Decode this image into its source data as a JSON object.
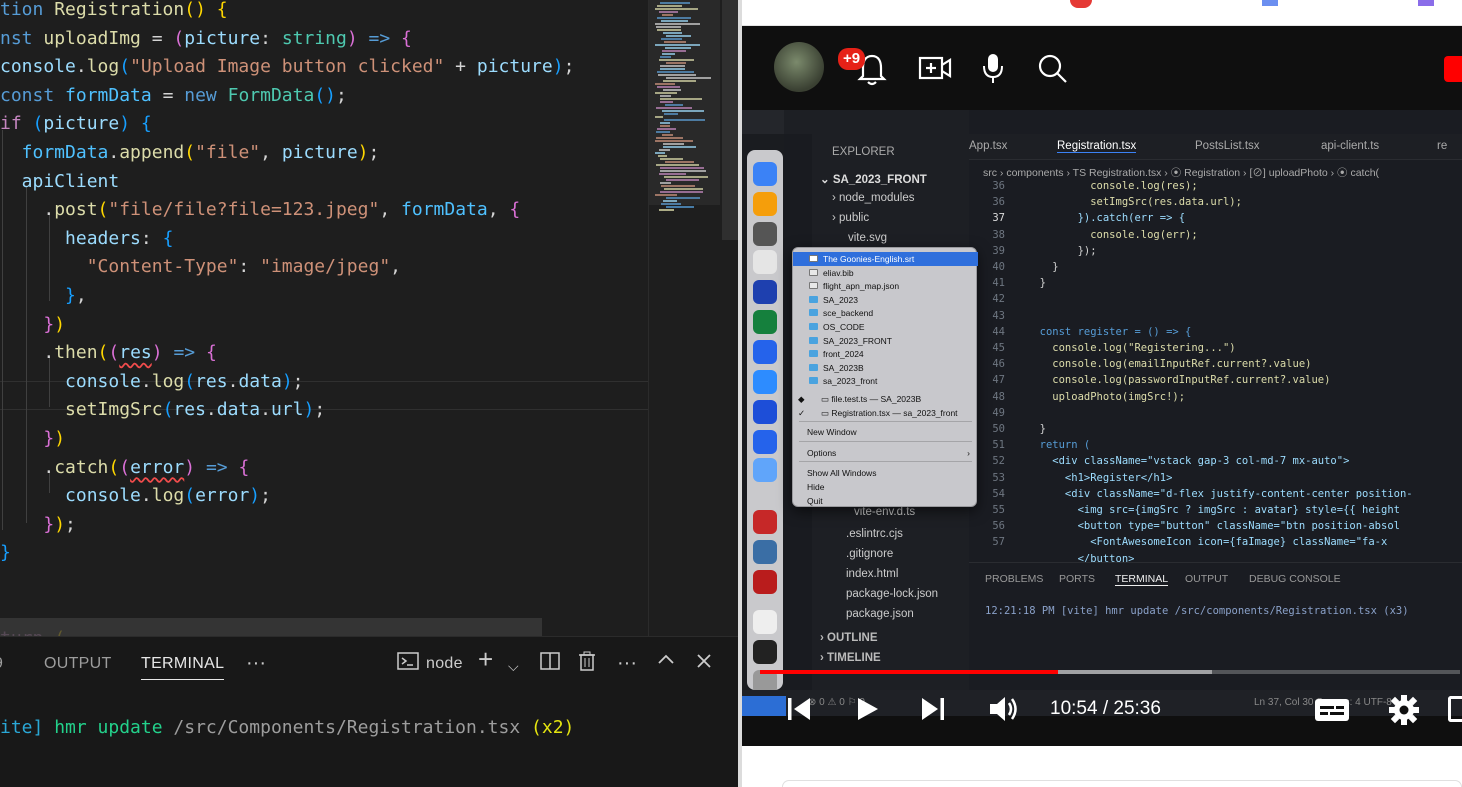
{
  "editor": {
    "lines": [
      [
        {
          "t": "tion ",
          "c": "#569cd6"
        },
        {
          "t": "Registration",
          "c": "#dcdcaa"
        },
        {
          "t": "() {",
          "c": "#ffd700"
        }
      ],
      [
        {
          "t": "nst ",
          "c": "#569cd6"
        },
        {
          "t": "uploadImg",
          "c": "#dcdcaa"
        },
        {
          "t": " = ",
          "c": "#d4d4d4"
        },
        {
          "t": "(",
          "c": "#da70d6"
        },
        {
          "t": "picture",
          "c": "#9cdcfe"
        },
        {
          "t": ": ",
          "c": "#d4d4d4"
        },
        {
          "t": "string",
          "c": "#4ec9b0"
        },
        {
          "t": ") ",
          "c": "#da70d6"
        },
        {
          "t": "=> ",
          "c": "#569cd6"
        },
        {
          "t": "{",
          "c": "#da70d6"
        }
      ],
      [
        {
          "t": "console",
          "c": "#9cdcfe"
        },
        {
          "t": ".",
          "c": "#d4d4d4"
        },
        {
          "t": "log",
          "c": "#dcdcaa"
        },
        {
          "t": "(",
          "c": "#179fff"
        },
        {
          "t": "\"Upload Image button clicked\"",
          "c": "#ce9178"
        },
        {
          "t": " + ",
          "c": "#d4d4d4"
        },
        {
          "t": "picture",
          "c": "#9cdcfe"
        },
        {
          "t": ")",
          "c": "#179fff"
        },
        {
          "t": ";",
          "c": "#d4d4d4"
        }
      ],
      [
        {
          "t": "const ",
          "c": "#569cd6"
        },
        {
          "t": "formData",
          "c": "#4fc1ff"
        },
        {
          "t": " = ",
          "c": "#d4d4d4"
        },
        {
          "t": "new ",
          "c": "#569cd6"
        },
        {
          "t": "FormData",
          "c": "#4ec9b0"
        },
        {
          "t": "()",
          "c": "#179fff"
        },
        {
          "t": ";",
          "c": "#d4d4d4"
        }
      ],
      [
        {
          "t": "if ",
          "c": "#c586c0"
        },
        {
          "t": "(",
          "c": "#179fff"
        },
        {
          "t": "picture",
          "c": "#9cdcfe"
        },
        {
          "t": ") ",
          "c": "#179fff"
        },
        {
          "t": "{",
          "c": "#179fff"
        }
      ],
      [
        {
          "t": "  formData",
          "c": "#4fc1ff"
        },
        {
          "t": ".",
          "c": "#d4d4d4"
        },
        {
          "t": "append",
          "c": "#dcdcaa"
        },
        {
          "t": "(",
          "c": "#ffd700"
        },
        {
          "t": "\"file\"",
          "c": "#ce9178"
        },
        {
          "t": ", ",
          "c": "#d4d4d4"
        },
        {
          "t": "picture",
          "c": "#9cdcfe"
        },
        {
          "t": ")",
          "c": "#ffd700"
        },
        {
          "t": ";",
          "c": "#d4d4d4"
        }
      ],
      [
        {
          "t": "  apiClient",
          "c": "#9cdcfe"
        }
      ],
      [
        {
          "t": "    .",
          "c": "#d4d4d4"
        },
        {
          "t": "post",
          "c": "#dcdcaa"
        },
        {
          "t": "(",
          "c": "#ffd700"
        },
        {
          "t": "\"file/file?file=123.jpeg\"",
          "c": "#ce9178"
        },
        {
          "t": ", ",
          "c": "#d4d4d4"
        },
        {
          "t": "formData",
          "c": "#4fc1ff"
        },
        {
          "t": ", ",
          "c": "#d4d4d4"
        },
        {
          "t": "{",
          "c": "#da70d6"
        }
      ],
      [
        {
          "t": "      headers",
          "c": "#9cdcfe"
        },
        {
          "t": ": ",
          "c": "#d4d4d4"
        },
        {
          "t": "{",
          "c": "#179fff"
        }
      ],
      [
        {
          "t": "        \"Content-Type\"",
          "c": "#ce9178"
        },
        {
          "t": ": ",
          "c": "#d4d4d4"
        },
        {
          "t": "\"image/jpeg\"",
          "c": "#ce9178"
        },
        {
          "t": ",",
          "c": "#d4d4d4"
        }
      ],
      [
        {
          "t": "      }",
          "c": "#179fff"
        },
        {
          "t": ",",
          "c": "#d4d4d4"
        }
      ],
      [
        {
          "t": "    }",
          "c": "#da70d6"
        },
        {
          "t": ")",
          "c": "#ffd700"
        }
      ],
      [
        {
          "t": "    .",
          "c": "#d4d4d4"
        },
        {
          "t": "then",
          "c": "#dcdcaa"
        },
        {
          "t": "(",
          "c": "#ffd700"
        },
        {
          "t": "(",
          "c": "#da70d6"
        },
        {
          "t": "res",
          "c": "#9cdcfe",
          "sq": true
        },
        {
          "t": ") ",
          "c": "#da70d6"
        },
        {
          "t": "=> ",
          "c": "#569cd6"
        },
        {
          "t": "{",
          "c": "#da70d6"
        }
      ],
      [
        {
          "t": "      console",
          "c": "#9cdcfe"
        },
        {
          "t": ".",
          "c": "#d4d4d4"
        },
        {
          "t": "log",
          "c": "#dcdcaa"
        },
        {
          "t": "(",
          "c": "#179fff"
        },
        {
          "t": "res",
          "c": "#9cdcfe"
        },
        {
          "t": ".",
          "c": "#d4d4d4"
        },
        {
          "t": "data",
          "c": "#9cdcfe"
        },
        {
          "t": ")",
          "c": "#179fff"
        },
        {
          "t": ";",
          "c": "#d4d4d4"
        }
      ],
      [
        {
          "t": "      setImgSrc",
          "c": "#dcdcaa"
        },
        {
          "t": "(",
          "c": "#179fff"
        },
        {
          "t": "res",
          "c": "#9cdcfe"
        },
        {
          "t": ".",
          "c": "#d4d4d4"
        },
        {
          "t": "data",
          "c": "#9cdcfe"
        },
        {
          "t": ".",
          "c": "#d4d4d4"
        },
        {
          "t": "url",
          "c": "#9cdcfe"
        },
        {
          "t": ")",
          "c": "#179fff"
        },
        {
          "t": ";",
          "c": "#d4d4d4"
        }
      ],
      [
        {
          "t": "    }",
          "c": "#da70d6"
        },
        {
          "t": ")",
          "c": "#ffd700"
        }
      ],
      [
        {
          "t": "    .",
          "c": "#d4d4d4"
        },
        {
          "t": "catch",
          "c": "#dcdcaa"
        },
        {
          "t": "(",
          "c": "#ffd700"
        },
        {
          "t": "(",
          "c": "#da70d6"
        },
        {
          "t": "error",
          "c": "#9cdcfe",
          "sq": true
        },
        {
          "t": ") ",
          "c": "#da70d6"
        },
        {
          "t": "=> ",
          "c": "#569cd6"
        },
        {
          "t": "{",
          "c": "#da70d6"
        }
      ],
      [
        {
          "t": "      console",
          "c": "#9cdcfe"
        },
        {
          "t": ".",
          "c": "#d4d4d4"
        },
        {
          "t": "log",
          "c": "#dcdcaa"
        },
        {
          "t": "(",
          "c": "#179fff"
        },
        {
          "t": "error",
          "c": "#9cdcfe"
        },
        {
          "t": ")",
          "c": "#179fff"
        },
        {
          "t": ";",
          "c": "#d4d4d4"
        }
      ],
      [
        {
          "t": "    }",
          "c": "#da70d6"
        },
        {
          "t": ")",
          "c": "#ffd700"
        },
        {
          "t": ";",
          "c": "#d4d4d4"
        }
      ],
      [
        {
          "t": "}",
          "c": "#179fff"
        }
      ],
      [],
      [],
      [
        {
          "t": "turn ",
          "c": "#c586c0"
        },
        {
          "t": "(",
          "c": "#ffd700"
        }
      ]
    ]
  },
  "panel": {
    "tabs": {
      "output": "OUTPUT",
      "terminal": "TERMINAL"
    },
    "tab_prefix": "9",
    "shell": "node",
    "terminal_line": [
      {
        "t": "ite]",
        "c": "#2aa7d6"
      },
      {
        "t": " hmr update ",
        "c": "#23d18b"
      },
      {
        "t": "/src/Components/Registration.tsx",
        "c": "#9d9d9d"
      },
      {
        "t": " (x2)",
        "c": "#e5e510"
      }
    ]
  },
  "youtube": {
    "notification_count": "+9",
    "time_current": "10:54",
    "time_total": "25:36",
    "progress": 0.426,
    "buffered": 0.645
  },
  "mac": {
    "search": "sa_2023_front",
    "explorer_title": "EXPLORER",
    "project": "SA_2023_FRONT",
    "explorer_items": [
      "node_modules",
      "public",
      "vite.svg"
    ],
    "explorer_items_bottom": [
      "vite-env.d.ts",
      ".eslintrc.cjs",
      ".gitignore",
      "index.html",
      "package-lock.json",
      "package.json"
    ],
    "outline": "OUTLINE",
    "timeline": "TIMELINE",
    "tabs": [
      "App.tsx",
      "Registration.tsx",
      "PostsList.tsx",
      "api-client.ts",
      "re"
    ],
    "breadcrumb": "src › components › TS Registration.tsx › ⦿ Registration › [⊘] uploadPhoto › ⦿ catch(",
    "code_lines": [
      {
        "n": "36",
        "t": "          console.log(res);"
      },
      {
        "n": "36",
        "t": "          setImgSrc(res.data.url);"
      },
      {
        "n": "37",
        "t": "        }).catch(err => {"
      },
      {
        "n": "38",
        "t": "          console.log(err);"
      },
      {
        "n": "39",
        "t": "        });"
      },
      {
        "n": "40",
        "t": "    }"
      },
      {
        "n": "41",
        "t": "  }"
      },
      {
        "n": "42",
        "t": ""
      },
      {
        "n": "43",
        "t": ""
      },
      {
        "n": "44",
        "t": "  const register = () => {"
      },
      {
        "n": "45",
        "t": "    console.log(\"Registering...\")"
      },
      {
        "n": "46",
        "t": "    console.log(emailInputRef.current?.value)"
      },
      {
        "n": "47",
        "t": "    console.log(passwordInputRef.current?.value)"
      },
      {
        "n": "48",
        "t": "    uploadPhoto(imgSrc!);"
      },
      {
        "n": "49",
        "t": ""
      },
      {
        "n": "50",
        "t": "  }"
      },
      {
        "n": "51",
        "t": "  return ("
      },
      {
        "n": "52",
        "t": "    <div className=\"vstack gap-3 col-md-7 mx-auto\">"
      },
      {
        "n": "53",
        "t": "      <h1>Register</h1>"
      },
      {
        "n": "54",
        "t": "      <div className=\"d-flex justify-content-center position-"
      },
      {
        "n": "55",
        "t": "        <img src={imgSrc ? imgSrc : avatar} style={{ height"
      },
      {
        "n": "56",
        "t": "        <button type=\"button\" className=\"btn position-absol"
      },
      {
        "n": "57",
        "t": "          <FontAwesomeIcon icon={faImage} className=\"fa-x"
      },
      {
        "n": "",
        "t": "        </button>"
      }
    ],
    "panel_tabs": [
      "PROBLEMS",
      "PORTS",
      "TERMINAL",
      "OUTPUT",
      "DEBUG CONSOLE"
    ],
    "terminal": "12:21:18 PM [vite] hmr update /src/components/Registration.tsx (x3)",
    "status": "Ln 37, Col 30   Spaces: 4   UTF-8   LF",
    "status_left": "⊗ 0 ⚠ 0   ⚐ 0",
    "menu": {
      "recent": [
        "The Goonies-English.srt",
        "eliav.bib",
        "flight_apn_map.json",
        "SA_2023",
        "sce_backend",
        "OS_CODE",
        "SA_2023_FRONT",
        "front_2024",
        "SA_2023B",
        "sa_2023_front"
      ],
      "windows": [
        "file.test.ts — SA_2023B",
        "Registration.tsx — sa_2023_front"
      ],
      "new_window": "New Window",
      "options": "Options",
      "show_all": "Show All Windows",
      "hide": "Hide",
      "quit": "Quit"
    }
  }
}
